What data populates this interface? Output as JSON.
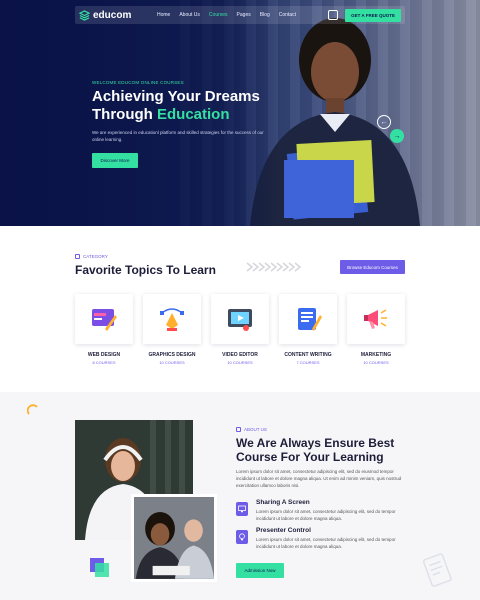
{
  "nav": {
    "logo": "educom",
    "items": [
      {
        "label": "Home",
        "active": false
      },
      {
        "label": "About Us",
        "active": false
      },
      {
        "label": "Courses",
        "active": true
      },
      {
        "label": "Pages",
        "active": false
      },
      {
        "label": "Blog",
        "active": false
      },
      {
        "label": "Contact",
        "active": false
      }
    ],
    "cta": "GET A FREE QUOTE"
  },
  "hero": {
    "kicker": "WELCOME EDUCOM ONLINE COURSES",
    "title_line1": "Achieving Your Dreams",
    "title_line2": "Through",
    "title_accent": "Education",
    "description": "We are experienced in educationl platform and skilled strategies for the success of our online learning.",
    "button": "Discover More",
    "prev_arrow": "←",
    "next_arrow": "→"
  },
  "topics": {
    "kicker": "CATEGORY",
    "title": "Favorite Topics To Learn",
    "browse_button": "Browse Educom Courses",
    "cards": [
      {
        "name": "WEB DESIGN",
        "count": "8 COURSES",
        "icon": "web-design-icon"
      },
      {
        "name": "GRAPHICS DESIGN",
        "count": "10 COURSES",
        "icon": "graphics-design-icon"
      },
      {
        "name": "VIDEO EDITOR",
        "count": "10 COURSES",
        "icon": "video-editor-icon"
      },
      {
        "name": "CONTENT WRITING",
        "count": "7 COURSES",
        "icon": "content-writing-icon"
      },
      {
        "name": "MARKETING",
        "count": "10 COURSES",
        "icon": "marketing-icon"
      }
    ]
  },
  "about": {
    "kicker": "ABOUT US",
    "title": "We Are Always Ensure Best Course For Your Learning",
    "description": "Lorem ipsum dolor sit amet, consectetur adipiscing elit, sed do eiusmod tempor incididunt ut labore et dolore magna aliqua. Ut enim ad minim veniam, quis nostrud exercitation ullamco laboris nisi.",
    "features": [
      {
        "title": "Sharing A Screen",
        "text": "Lorem ipsum dolor sit amet, consectetur adipiscing elit, sed do tempor incididunt ut labore et dolore magna aliqua.",
        "icon": "monitor-icon"
      },
      {
        "title": "Presenter Control",
        "text": "Lorem ipsum dolor sit amet, consectetur adipiscing elit, sed do tempor incididunt ut labore et dolore magna aliqua.",
        "icon": "bulb-icon"
      }
    ],
    "button": "Admission Now"
  },
  "colors": {
    "navy": "#0d1a4e",
    "mint": "#34e0a1",
    "purple": "#6c5ce7"
  }
}
